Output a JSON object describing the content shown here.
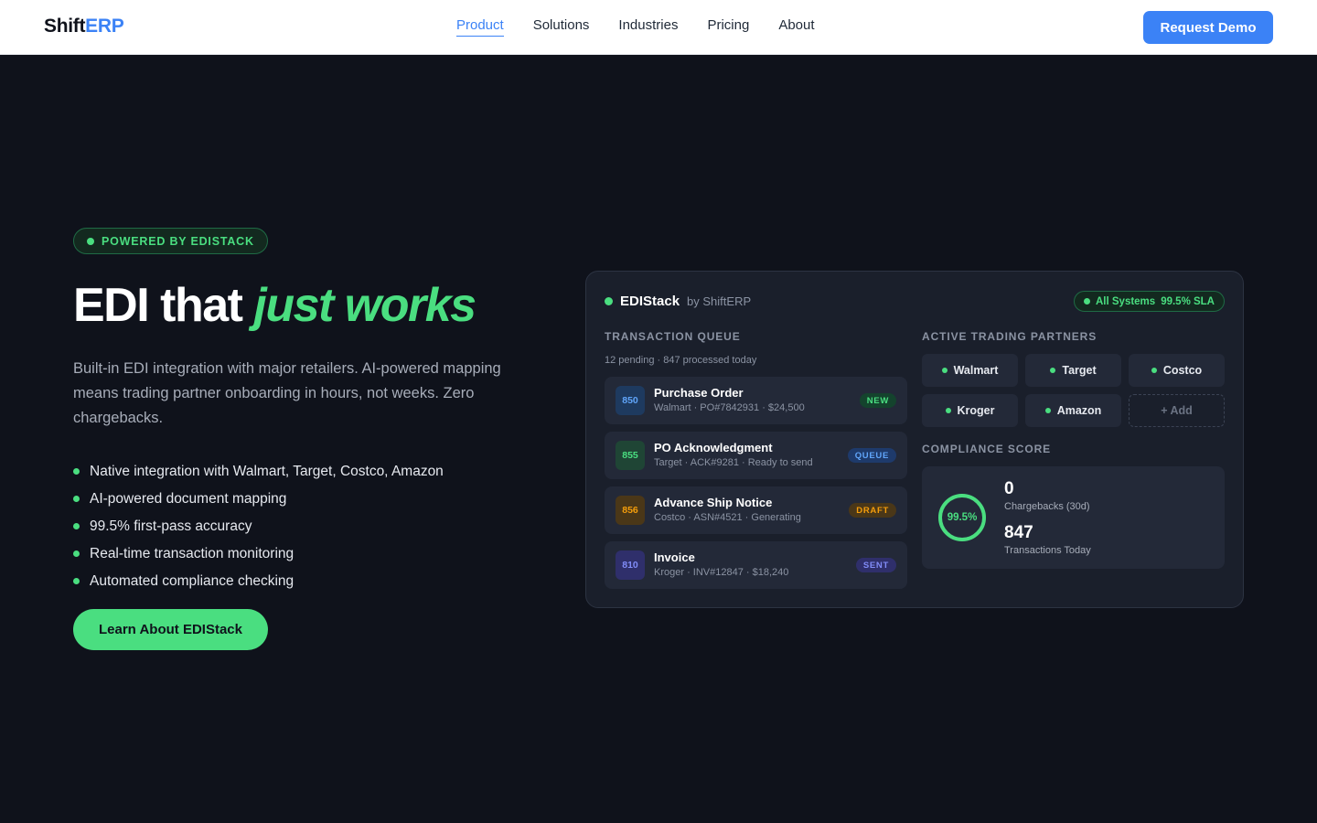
{
  "header": {
    "logo_part1": "Shift",
    "logo_part2": "ERP",
    "nav": [
      "Product",
      "Solutions",
      "Industries",
      "Pricing",
      "About"
    ],
    "active_nav": "Product",
    "cta": "Request Demo"
  },
  "hero": {
    "badge": "POWERED BY EDISTACK",
    "headline_plain": "EDI that ",
    "headline_accent": "just works",
    "lead": "Built-in EDI integration with major retailers. AI-powered mapping means trading partner onboarding in hours, not weeks. Zero chargebacks.",
    "features": [
      "Native integration with Walmart, Target, Costco, Amazon",
      "AI-powered document mapping",
      "99.5% first-pass accuracy",
      "Real-time transaction monitoring",
      "Automated compliance checking"
    ],
    "cta": "Learn About EDIStack"
  },
  "panel": {
    "name": "EDIStack",
    "by": "by ShiftERP",
    "status_label": "All Systems",
    "status_sla": "99.5% SLA",
    "queue_title": "TRANSACTION QUEUE",
    "queue_sub": "12 pending · 847 processed today",
    "transactions": [
      {
        "code": "850",
        "title": "Purchase Order",
        "meta": "Walmart · PO#7842931 · $24,500",
        "badge": "NEW"
      },
      {
        "code": "855",
        "title": "PO Acknowledgment",
        "meta": "Target · ACK#9281 · Ready to send",
        "badge": "QUEUE"
      },
      {
        "code": "856",
        "title": "Advance Ship Notice",
        "meta": "Costco · ASN#4521 · Generating",
        "badge": "DRAFT"
      },
      {
        "code": "810",
        "title": "Invoice",
        "meta": "Kroger · INV#12847 · $18,240",
        "badge": "SENT"
      }
    ],
    "partners_title": "ACTIVE TRADING PARTNERS",
    "partners": [
      "Walmart",
      "Target",
      "Costco",
      "Kroger",
      "Amazon"
    ],
    "add_partner": "+ Add",
    "compliance_title": "COMPLIANCE SCORE",
    "compliance_score": "99.5%",
    "compliance_fraction": 0.995,
    "stats": [
      {
        "value": "0",
        "label": "Chargebacks (30d)"
      },
      {
        "value": "847",
        "label": "Transactions Today"
      }
    ]
  },
  "colors": {
    "accent_blue": "#3b82f6",
    "accent_green": "#4ade80",
    "background": "#0f121b",
    "panel": "#1a1f2b"
  }
}
